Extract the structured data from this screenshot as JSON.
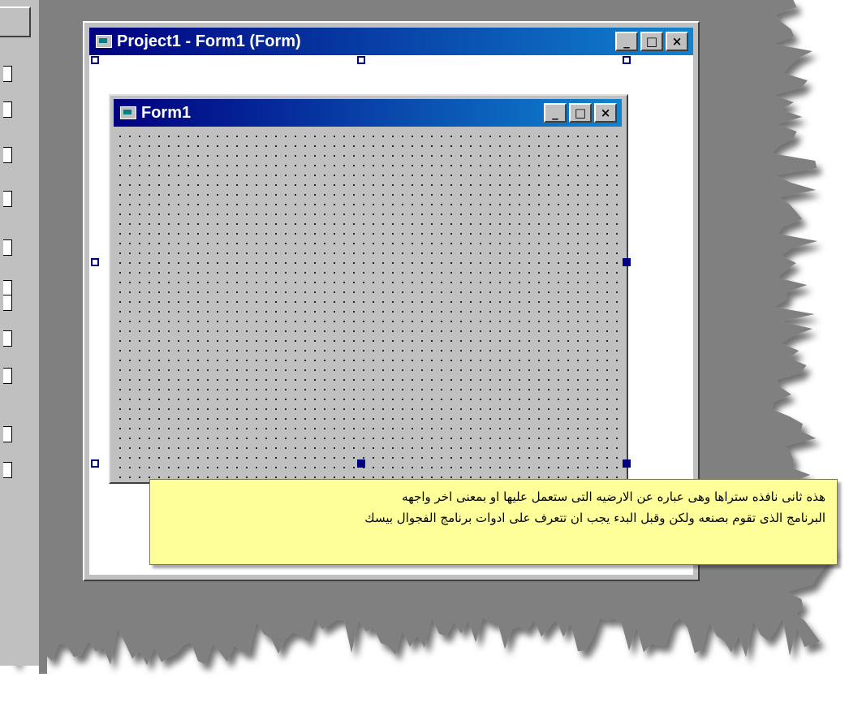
{
  "project_window": {
    "title": "Project1 - Form1 (Form)",
    "min_label": "_",
    "max_label": "□",
    "close_label": "×"
  },
  "form_window": {
    "title": "Form1",
    "min_label": "_",
    "max_label": "□",
    "close_label": "×"
  },
  "toolbox": {
    "tools": [
      {
        "icon": "pointer-icon"
      },
      {
        "icon": "picturebox-icon"
      },
      {
        "icon": "label-icon"
      },
      {
        "icon": "textbox-icon"
      },
      {
        "icon": "frame-icon"
      },
      {
        "icon": "commandbutton-icon"
      },
      {
        "icon": "checkbox-icon"
      },
      {
        "icon": "optionbutton-icon"
      },
      {
        "icon": "combobox-icon"
      },
      {
        "icon": "listbox-icon"
      },
      {
        "icon": "hscrollbar-icon"
      },
      {
        "icon": "vscrollbar-icon"
      }
    ]
  },
  "note": {
    "line1": "هذه ثانى نافذه ستراها وهى عباره عن الارضيه التى ستعمل عليها او بمعنى اخر واجهه",
    "line2": "البرنامج الذى تقوم بصنعه ولكن وقبل البدء يجب ان تتعرف على ادوات برنامج الفجوال بيسك"
  },
  "colors": {
    "titlebar_start": "#000080",
    "titlebar_end": "#1084d0",
    "face": "#c0c0c0",
    "note_background": "#ffff99",
    "handle": "#000080"
  }
}
